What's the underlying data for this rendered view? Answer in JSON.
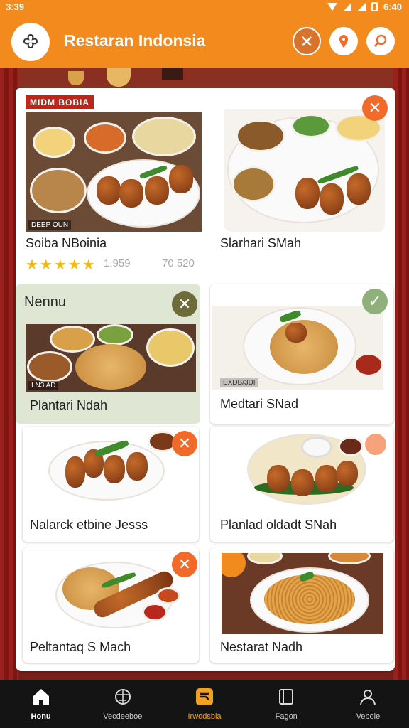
{
  "status_bar": {
    "time": "3:39",
    "right_time": "6:40"
  },
  "header": {
    "title": "Restaran Indonsia"
  },
  "icons": {
    "logo": "flower-logo-icon",
    "close": "close-icon",
    "location": "location-pin-icon",
    "search": "search-icon"
  },
  "colors": {
    "accent": "#f28a1e",
    "active_tab": "#f2a21e",
    "close_badge": "#f26a2a"
  },
  "featured": {
    "tag": "MIDM BOBIA",
    "image_tag": "DEEP OUN",
    "left_name": "Soiba NBoinia",
    "right_name": "Slarhari SMah",
    "rating": "4.5",
    "rating_a": "1.959",
    "rating_b": "70 520"
  },
  "menu_panel": {
    "title": "Nennu",
    "image_tag": "I.N3 AD",
    "item_name": "Plantari Ndah"
  },
  "cards": [
    {
      "name": "Medtari SNad",
      "image_tag": "EXDB/3DI"
    },
    {
      "name": "Nalarck etbine Jesss"
    },
    {
      "name": "Planlad oldadt SNah"
    },
    {
      "name": "Peltantaq S Mach"
    },
    {
      "name": "Nestarat Nadh"
    }
  ],
  "nav": [
    {
      "label": "Honu",
      "icon": "home-icon"
    },
    {
      "label": "Vecdeeboe",
      "icon": "shield-icon"
    },
    {
      "label": "Irwodsbia",
      "icon": "food-icon"
    },
    {
      "label": "Fagon",
      "icon": "book-icon"
    },
    {
      "label": "Veboie",
      "icon": "profile-icon"
    }
  ]
}
